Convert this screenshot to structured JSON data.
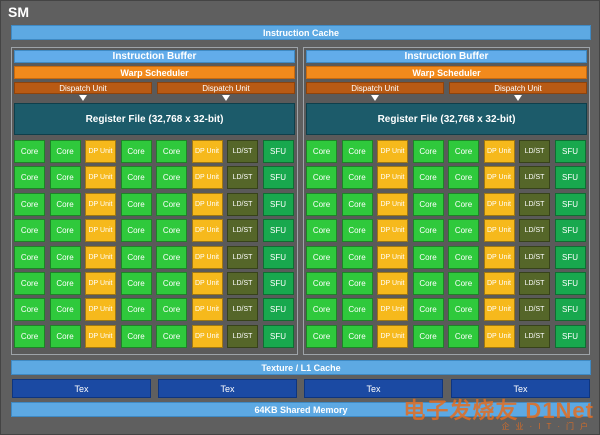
{
  "title": "SM",
  "instruction_cache": "Instruction Cache",
  "halves": [
    {
      "instruction_buffer": "Instruction Buffer",
      "warp_scheduler": "Warp Scheduler",
      "dispatch_units": [
        "Dispatch Unit",
        "Dispatch Unit"
      ],
      "register_file": "Register File (32,768 x 32-bit)"
    },
    {
      "instruction_buffer": "Instruction Buffer",
      "warp_scheduler": "Warp Scheduler",
      "dispatch_units": [
        "Dispatch Unit",
        "Dispatch Unit"
      ],
      "register_file": "Register File (32,768 x 32-bit)"
    }
  ],
  "unit_row": [
    "Core",
    "Core",
    "DP Unit",
    "Core",
    "Core",
    "DP Unit",
    "LD/ST",
    "SFU"
  ],
  "unit_rows_per_half": 8,
  "texture_l1_cache": "Texture / L1 Cache",
  "tex_units": [
    "Tex",
    "Tex",
    "Tex",
    "Tex"
  ],
  "shared_memory": "64KB Shared Memory",
  "watermark": {
    "brand": "电子发烧友 D1Net",
    "subtitle": "企业·IT·门户"
  },
  "colors": {
    "frame": "#5f5f5f",
    "cache_bar": "#5da9e3",
    "warp_scheduler": "#f28a1c",
    "dispatch_unit": "#b85a14",
    "register_file": "#1c5b6a",
    "core": "#2fc93c",
    "dp_unit": "#f6b91c",
    "ldst": "#556629",
    "sfu": "#18a84e",
    "tex": "#1b4aa3"
  }
}
